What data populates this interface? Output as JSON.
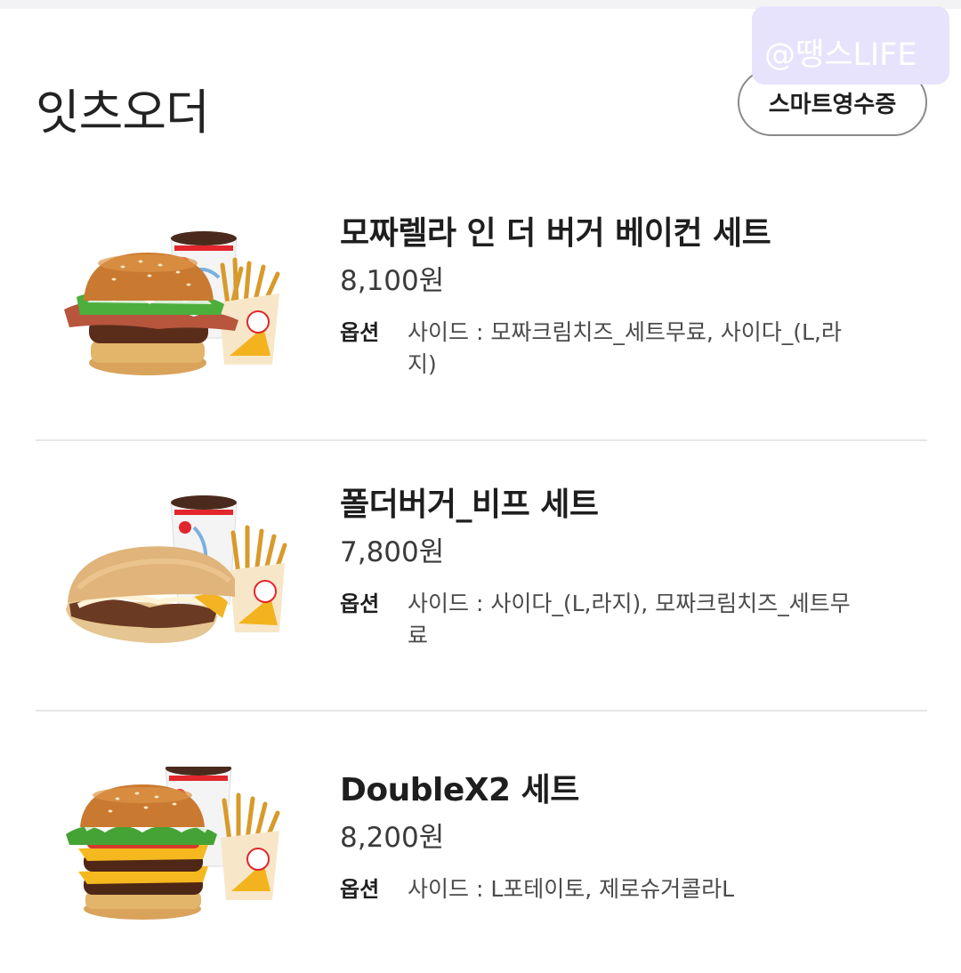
{
  "header": {
    "title": "잇츠오더",
    "smart_receipt_label": "스마트영수증",
    "watermark": "@땡스LIFE"
  },
  "orders": [
    {
      "name": "모짜렐라 인 더 버거 베이컨 세트",
      "price": "8,100원",
      "option_label": "옵션",
      "option_text": "사이드 : 모짜크림치즈_세트무료, 사이다_(L,라지)",
      "image": "burger-set-image"
    },
    {
      "name": "폴더버거_비프 세트",
      "price": "7,800원",
      "option_label": "옵션",
      "option_text": "사이드 : 사이다_(L,라지), 모짜크림치즈_세트무료",
      "image": "folder-burger-set-image"
    },
    {
      "name": "DoubleX2 세트",
      "price": "8,200원",
      "option_label": "옵션",
      "option_text": "사이드 : L포테이토, 제로슈거콜라L",
      "image": "double-burger-set-image"
    }
  ],
  "colors": {
    "watermark_bg": "#e8e3fc",
    "divider": "#e6e6e6",
    "text": "#1e1e1e"
  }
}
